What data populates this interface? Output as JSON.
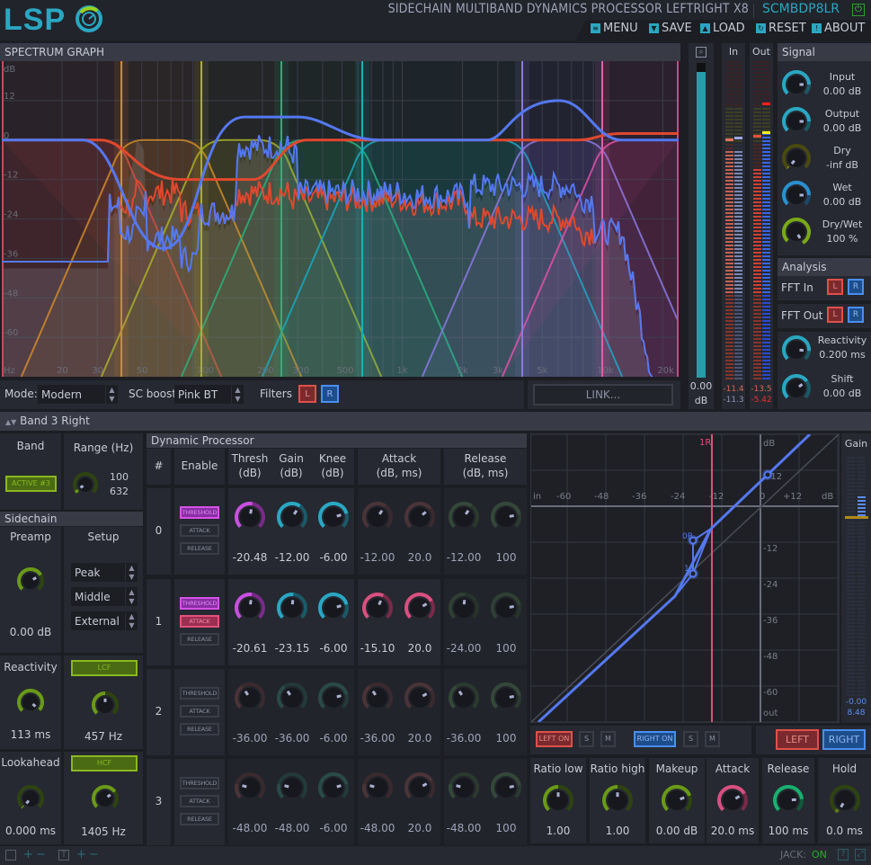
{
  "app": {
    "logo": "LSP",
    "title": "SIDECHAIN MULTIBAND DYNAMICS PROCESSOR LEFTRIGHT X8",
    "short_name": "SCMBDP8LR",
    "power_icon": "power-icon"
  },
  "menu": {
    "items": [
      {
        "label": "MENU",
        "icon": "menu-icon"
      },
      {
        "label": "SAVE",
        "icon": "save-icon"
      },
      {
        "label": "LOAD",
        "icon": "load-icon"
      },
      {
        "label": "RESET",
        "icon": "reset-icon"
      },
      {
        "label": "ABOUT",
        "icon": "about-icon"
      }
    ]
  },
  "spectrum": {
    "header": "SPECTRUM GRAPH",
    "y_labels": [
      "dB",
      "12",
      "0",
      "-12",
      "-24",
      "-36",
      "-48",
      "-60"
    ],
    "x_labels": [
      "Hz",
      "20",
      "30",
      "50",
      "100",
      "200",
      "300",
      "500",
      "1k",
      "2k",
      "3k",
      "5k",
      "10k",
      "20k"
    ],
    "band_split_colors": [
      "#d08a2a",
      "#a8b02a",
      "#2ab07a",
      "#18b0b8",
      "#8a78e0",
      "#e060a8"
    ]
  },
  "controls": {
    "mode_label": "Mode:",
    "mode_value": "Modern",
    "scboost_label": "SC boost:",
    "scboost_value": "Pink BT",
    "filters_label": "Filters",
    "filter_l": "L",
    "filter_r": "R",
    "link_label": "LINK..."
  },
  "zoom_meter": {
    "icon": "zoom-icon",
    "value": "0.00",
    "unit": "dB"
  },
  "meters": {
    "in_label": "In",
    "out_label": "Out",
    "in_values": [
      "-11.4",
      "-11.3"
    ],
    "out_values": [
      "-13.5",
      "-5.42"
    ]
  },
  "signal": {
    "header": "Signal",
    "knobs": [
      {
        "label": "Input",
        "value": "0.00 dB"
      },
      {
        "label": "Output",
        "value": "0.00 dB"
      },
      {
        "label": "Dry",
        "value": "-inf dB"
      },
      {
        "label": "Wet",
        "value": "0.00 dB"
      },
      {
        "label": "Dry/Wet",
        "value": "100 %"
      }
    ]
  },
  "analysis": {
    "header": "Analysis",
    "fft_in": "FFT In",
    "fft_out": "FFT Out",
    "l": "L",
    "r": "R",
    "reactivity_label": "Reactivity",
    "reactivity_value": "0.200 ms",
    "shift_label": "Shift",
    "shift_value": "0.00 dB"
  },
  "band": {
    "selector": "Band 3 Right",
    "band_label": "Band",
    "active_label": "ACTIVE #3",
    "range_label": "Range (Hz)",
    "range_low": "100",
    "range_high": "632",
    "sidechain_header": "Sidechain",
    "preamp_label": "Preamp",
    "preamp_value": "0.00 dB",
    "setup_label": "Setup",
    "setup_options": [
      "Peak",
      "Middle",
      "External"
    ],
    "reactivity_label": "Reactivity",
    "reactivity_value": "113 ms",
    "lcf_label": "LCF",
    "lcf_value": "457 Hz",
    "lookahead_label": "Lookahead",
    "lookahead_value": "0.000 ms",
    "hcf_label": "HCF",
    "hcf_value": "1405 Hz"
  },
  "dynproc": {
    "header": "Dynamic Processor",
    "columns": {
      "num": "#",
      "enable": "Enable",
      "thresh": [
        "Thresh",
        "(dB)"
      ],
      "gain": [
        "Gain",
        "(dB)"
      ],
      "knee": [
        "Knee",
        "(dB)"
      ],
      "attack": [
        "Attack",
        "(dB, ms)"
      ],
      "release": [
        "Release",
        "(dB, ms)"
      ]
    },
    "enable_labels": [
      "THRESHOLD",
      "ATTACK",
      "RELEASE"
    ],
    "rows": [
      {
        "num": "0",
        "threshold_on": true,
        "attack_on": false,
        "release_on": false,
        "thresh": "-20.48",
        "gain": "-12.00",
        "knee": "-6.00",
        "attack_db": "-12.00",
        "attack_ms": "20.0",
        "release_db": "-12.00",
        "release_ms": "100"
      },
      {
        "num": "1",
        "threshold_on": true,
        "attack_on": true,
        "release_on": false,
        "thresh": "-20.61",
        "gain": "-23.15",
        "knee": "-6.00",
        "attack_db": "-15.10",
        "attack_ms": "20.0",
        "release_db": "-24.00",
        "release_ms": "100"
      },
      {
        "num": "2",
        "threshold_on": false,
        "attack_on": false,
        "release_on": false,
        "thresh": "-36.00",
        "gain": "-36.00",
        "knee": "-6.00",
        "attack_db": "-36.00",
        "attack_ms": "20.0",
        "release_db": "-36.00",
        "release_ms": "100"
      },
      {
        "num": "3",
        "threshold_on": false,
        "attack_on": false,
        "release_on": false,
        "thresh": "-48.00",
        "gain": "-48.00",
        "knee": "-6.00",
        "attack_db": "-48.00",
        "attack_ms": "20.0",
        "release_db": "-48.00",
        "release_ms": "100"
      }
    ]
  },
  "curve": {
    "x_labels": [
      "in",
      "-60",
      "-48",
      "-36",
      "-24",
      "-12",
      "0",
      "+12",
      "dB"
    ],
    "y_labels": [
      "dB",
      "+12",
      "-12",
      "-24",
      "-36",
      "-48",
      "-60",
      "out"
    ],
    "marker_label": "1R",
    "point_labels": [
      "0R",
      "1R"
    ]
  },
  "gain_meter": {
    "label": "Gain",
    "values": [
      "-0.00",
      "8.48"
    ]
  },
  "channel": {
    "left_on": "LEFT ON",
    "right_on": "RIGHT ON",
    "solo": "S",
    "mute": "M",
    "left": "LEFT",
    "right": "RIGHT"
  },
  "bottom_knobs": [
    {
      "label": "Ratio low",
      "value": "1.00"
    },
    {
      "label": "Ratio high",
      "value": "1.00"
    },
    {
      "label": "Makeup",
      "value": "0.00 dB"
    },
    {
      "label": "Attack",
      "value": "20.0 ms"
    },
    {
      "label": "Release",
      "value": "100 ms"
    },
    {
      "label": "Hold",
      "value": "0.0 ms"
    }
  ],
  "statusbar": {
    "plus": "+",
    "minus": "−",
    "jack_label": "JACK:",
    "jack_value": "ON",
    "help": "?"
  }
}
